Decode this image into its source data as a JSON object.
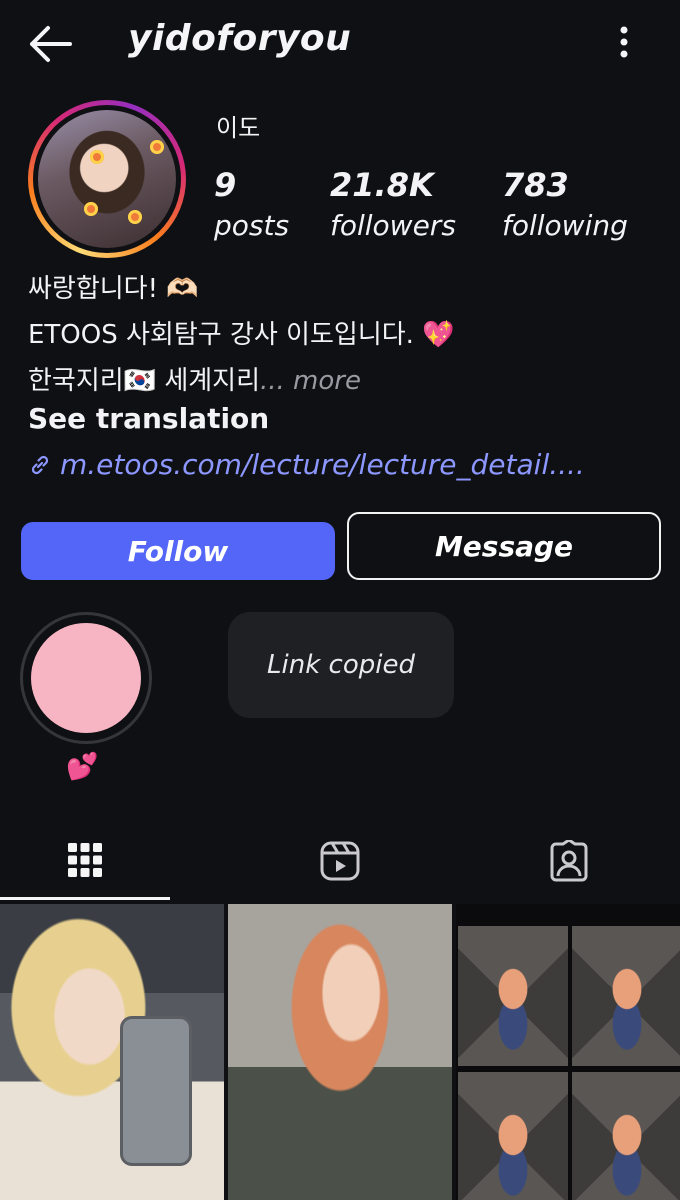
{
  "header": {
    "username": "yidoforyou",
    "back_icon": "arrow-left-icon",
    "menu_icon": "more-vertical-icon"
  },
  "profile": {
    "display_name": "이도",
    "stats": {
      "posts": {
        "value": "9",
        "label": "posts"
      },
      "followers": {
        "value": "21.8K",
        "label": "followers"
      },
      "following": {
        "value": "783",
        "label": "following"
      }
    },
    "bio_lines": [
      "싸랑합니다! 🫶🏻",
      "ETOOS 사회탐구 강사 이도입니다. 💖",
      "한국지리🇰🇷 세계지리"
    ],
    "more_label": "... more",
    "see_translation": "See translation",
    "link": "m.etoos.com/lecture/lecture_detail....",
    "link_icon": "link-icon"
  },
  "actions": {
    "follow_label": "Follow",
    "message_label": "Message"
  },
  "highlights": [
    {
      "emoji": "💕"
    }
  ],
  "toast": {
    "text": "Link copied"
  },
  "tabs": [
    {
      "icon": "grid-icon",
      "active": true
    },
    {
      "icon": "reels-icon",
      "active": false
    },
    {
      "icon": "tagged-icon",
      "active": false
    }
  ],
  "colors": {
    "background": "#0f1013",
    "follow_button": "#5366f7",
    "link": "#8c97ff",
    "muted_text": "#9a9aa2"
  }
}
